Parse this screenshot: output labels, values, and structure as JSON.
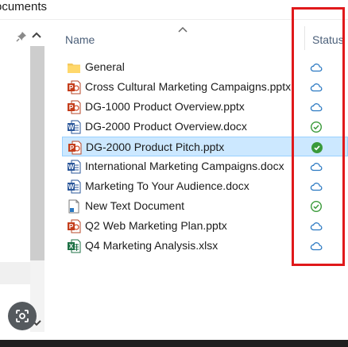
{
  "breadcrumb": "ocuments",
  "header": {
    "name": "Name",
    "status": "Status"
  },
  "files": [
    {
      "name": "General",
      "type": "folder",
      "status": "cloud"
    },
    {
      "name": "Cross Cultural Marketing Campaigns.pptx",
      "type": "pptx",
      "status": "cloud"
    },
    {
      "name": "DG-1000 Product Overview.pptx",
      "type": "pptx",
      "status": "cloud"
    },
    {
      "name": "DG-2000 Product Overview.docx",
      "type": "docx",
      "status": "available"
    },
    {
      "name": "DG-2000 Product Pitch.pptx",
      "type": "pptx",
      "status": "always-available",
      "selected": true
    },
    {
      "name": "International Marketing Campaigns.docx",
      "type": "docx",
      "status": "cloud"
    },
    {
      "name": "Marketing To Your Audience.docx",
      "type": "docx",
      "status": "cloud"
    },
    {
      "name": "New Text Document",
      "type": "txt",
      "status": "available"
    },
    {
      "name": "Q2 Web Marketing Plan.pptx",
      "type": "pptx",
      "status": "cloud"
    },
    {
      "name": "Q4 Marketing Analysis.xlsx",
      "type": "xlsx",
      "status": "cloud"
    }
  ],
  "colors": {
    "selection": "#cce8ff",
    "annotation": "#e0191b",
    "cloud": "#2b79c2",
    "available": "#3a9a3a"
  }
}
